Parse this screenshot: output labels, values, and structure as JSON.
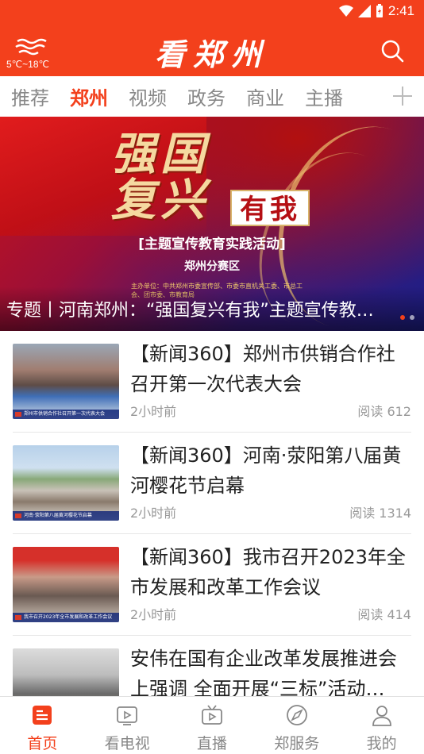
{
  "status_bar": {
    "time": "2:41"
  },
  "header": {
    "temperature": "5℃~18℃",
    "logo_text": "看郑州",
    "weather_icon": "haze-icon",
    "search_icon": "search-icon"
  },
  "tabs": [
    {
      "label": "推荐",
      "active": false
    },
    {
      "label": "郑州",
      "active": true
    },
    {
      "label": "视频",
      "active": false
    },
    {
      "label": "政务",
      "active": false
    },
    {
      "label": "商业",
      "active": false
    },
    {
      "label": "主播",
      "active": false
    }
  ],
  "banner": {
    "calligraphy": "强国复兴",
    "highlight": "有我",
    "subtitle": "[主题宣传教育实践活动]",
    "subtitle2": "郑州分赛区",
    "organizers": "主办单位：中共郑州市委宣传部、市委市直机关工委、市总工会、团市委、市教育局",
    "caption": "专题丨河南郑州：“强国复兴有我”主题宣传教…"
  },
  "news": [
    {
      "title": "【新闻360】郑州市供销合作社召开第一次代表大会",
      "time": "2小时前",
      "reads": "阅读 612",
      "thumb_caption": "郑州市供销合作社召开第一次代表大会"
    },
    {
      "title": "【新闻360】河南·荥阳第八届黄河樱花节启幕",
      "time": "2小时前",
      "reads": "阅读 1314",
      "thumb_caption": "河南·荥阳第八届黄河樱花节启幕"
    },
    {
      "title": "【新闻360】我市召开2023年全市发展和改革工作会议",
      "time": "2小时前",
      "reads": "阅读 414",
      "thumb_caption": "我市召开2023年全市发展和改革工作会议"
    },
    {
      "title": "安伟在国有企业改革发展推进会上强调 全面开展“三标”活动…",
      "time": "",
      "reads": "",
      "thumb_caption": ""
    }
  ],
  "bottom_nav": [
    {
      "label": "首页",
      "icon": "home-news-icon",
      "active": true
    },
    {
      "label": "看电视",
      "icon": "tv-icon",
      "active": false
    },
    {
      "label": "直播",
      "icon": "live-icon",
      "active": false
    },
    {
      "label": "郑服务",
      "icon": "service-icon",
      "active": false
    },
    {
      "label": "我的",
      "icon": "profile-icon",
      "active": false
    }
  ],
  "colors": {
    "brand": "#f3401c",
    "muted": "#888888",
    "meta": "#999999"
  }
}
